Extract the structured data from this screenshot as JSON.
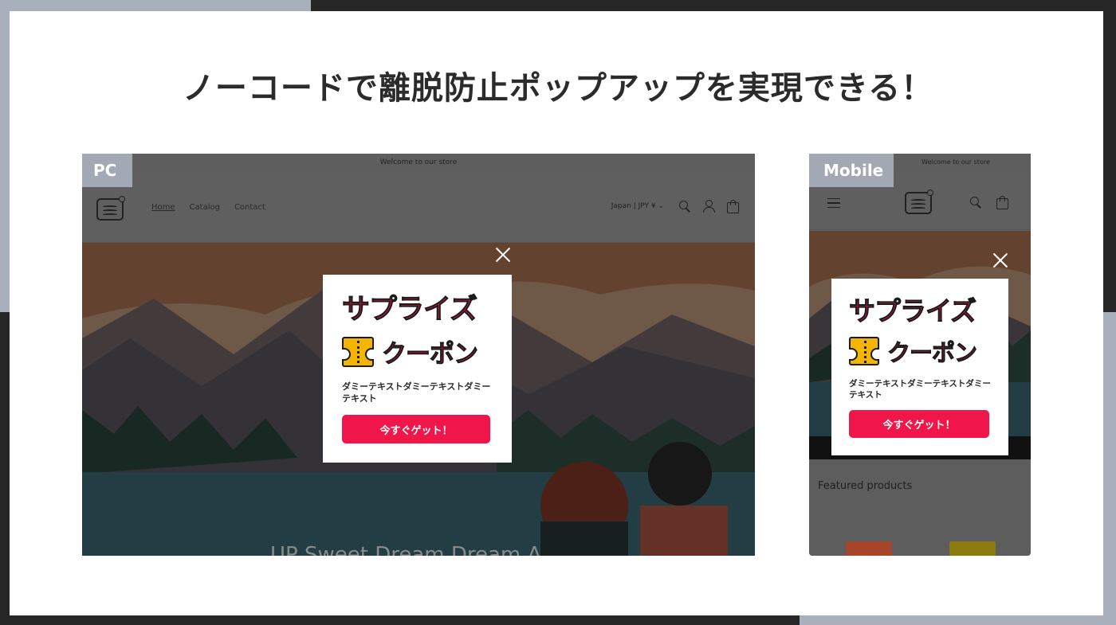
{
  "slide": {
    "title": "ノーコードで離脱防止ポップアップを実現できる！"
  },
  "pc": {
    "tag": "PC",
    "announcement": "Welcome to our store",
    "nav": [
      "Home",
      "Catalog",
      "Contact"
    ],
    "locale": "Japan | JPY ¥  ⌄",
    "hero_text": "UP Sweet Dream Dream A"
  },
  "mobile": {
    "tag": "Mobile",
    "announcement": "Welcome to our store",
    "featured_title": "Featured products"
  },
  "popup": {
    "title_line1": "サプライズ",
    "title_line2": "クーポン",
    "body": "ダミーテキストダミーテキストダミーテキスト",
    "cta": "今すぐゲット！"
  },
  "colors": {
    "accent": "#f01649",
    "ticket": "#f5b400",
    "frame": "#a9b0bc"
  }
}
